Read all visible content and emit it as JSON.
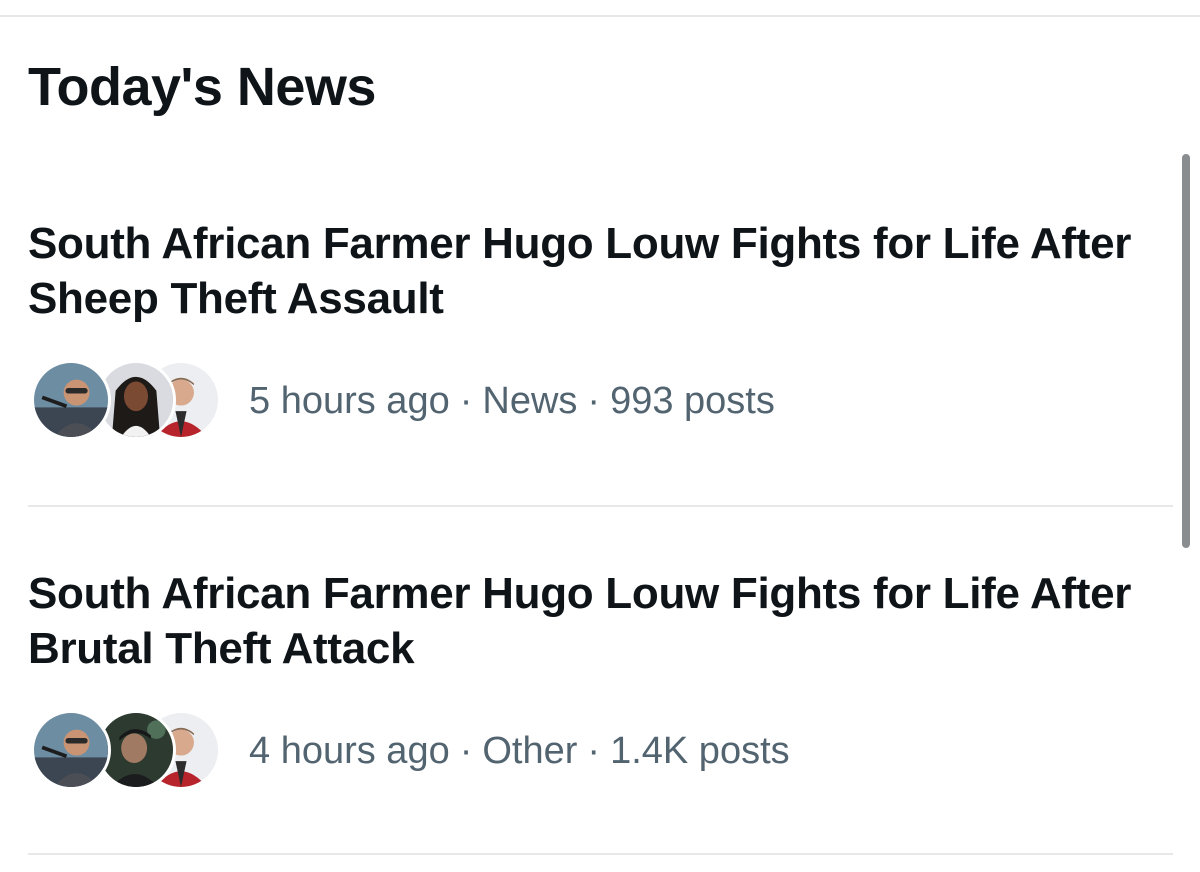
{
  "section": {
    "title": "Today's News"
  },
  "news": [
    {
      "headline": "South African Farmer Hugo Louw Fights for Life After Sheep Theft Assault",
      "time": "5 hours ago",
      "category": "News",
      "posts": "993 posts",
      "avatars": [
        "man-with-microphone-avatar",
        "woman-with-braids-avatar",
        "man-in-red-jacket-avatar"
      ]
    },
    {
      "headline": "South African Farmer Hugo Louw Fights for Life After Brutal Theft Attack",
      "time": "4 hours ago",
      "category": "Other",
      "posts": "1.4K posts",
      "avatars": [
        "man-with-microphone-avatar",
        "man-in-cap-avatar",
        "man-in-red-jacket-avatar"
      ]
    }
  ],
  "separator": "·",
  "colors": {
    "headline_text": "#0f1419",
    "meta_text": "#536471",
    "divider": "#e6e8ea",
    "background": "#ffffff"
  }
}
